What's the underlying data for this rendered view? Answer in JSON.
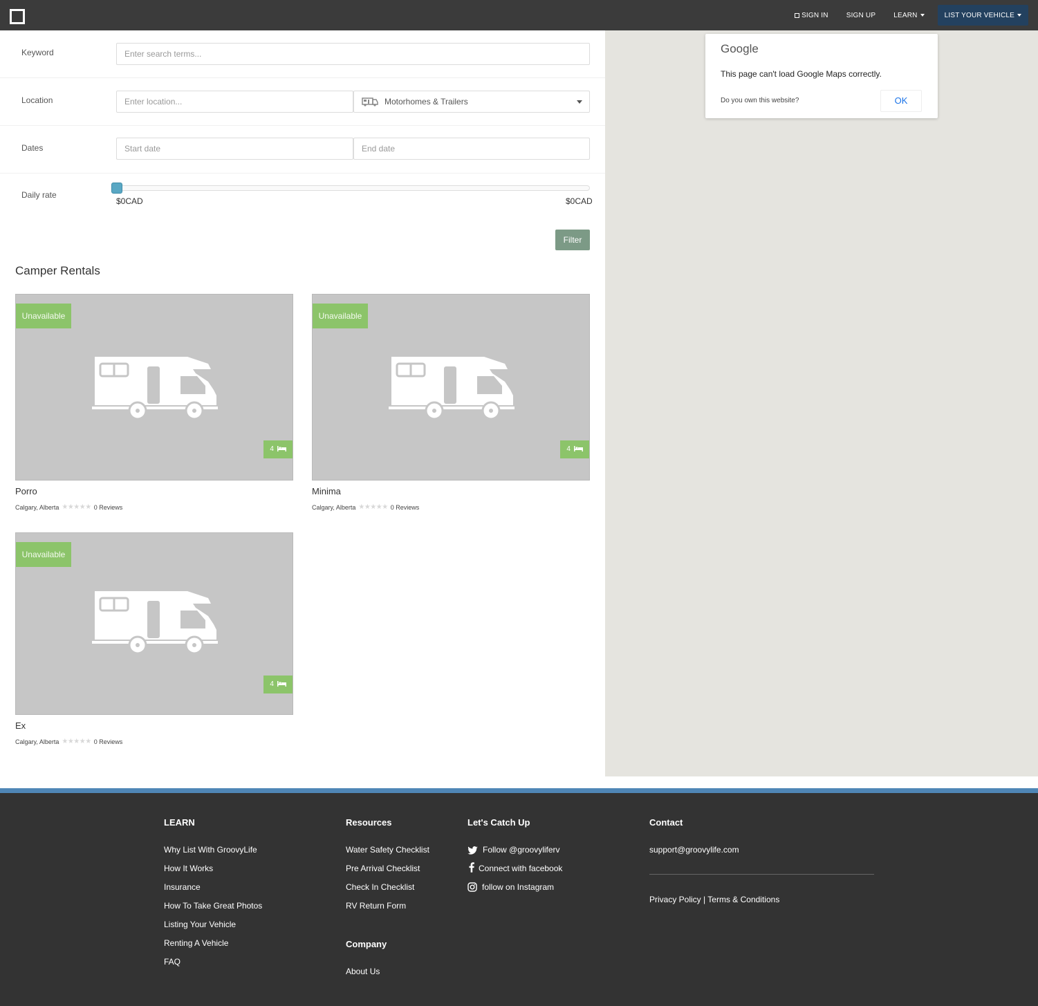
{
  "nav": {
    "sign_in": "SIGN IN",
    "sign_up": "SIGN UP",
    "learn": "LEARN",
    "list_vehicle": "LIST YOUR VEHICLE"
  },
  "search": {
    "keyword_label": "Keyword",
    "keyword_placeholder": "Enter search terms...",
    "location_label": "Location",
    "location_placeholder": "Enter location...",
    "vehicle_type": "Motorhomes & Trailers",
    "dates_label": "Dates",
    "start_placeholder": "Start date",
    "end_placeholder": "End date",
    "rate_label": "Daily rate",
    "rate_min": "$0CAD",
    "rate_max": "$0CAD",
    "filter_button": "Filter"
  },
  "section_title": "Camper Rentals",
  "listings": [
    {
      "status": "Unavailable",
      "beds": "4",
      "name": "Porro",
      "location": "Calgary, Alberta",
      "rating": 0,
      "reviews": "0 Reviews"
    },
    {
      "status": "Unavailable",
      "beds": "4",
      "name": "Minima",
      "location": "Calgary, Alberta",
      "rating": 0,
      "reviews": "0 Reviews"
    },
    {
      "status": "Unavailable",
      "beds": "4",
      "name": "Ex",
      "location": "Calgary, Alberta",
      "rating": 0,
      "reviews": "0 Reviews"
    }
  ],
  "map_error": {
    "brand": "Google",
    "message": "This page can't load Google Maps correctly.",
    "question": "Do you own this website?",
    "ok": "OK"
  },
  "footer": {
    "learn": {
      "heading": "LEARN",
      "links": [
        "Why List With GroovyLife",
        "How It Works",
        "Insurance",
        "How To Take Great Photos",
        "Listing Your Vehicle",
        "Renting A Vehicle",
        "FAQ"
      ]
    },
    "resources": {
      "heading": "Resources",
      "links": [
        "Water Safety Checklist",
        "Pre Arrival Checklist",
        "Check In Checklist",
        "RV Return Form"
      ]
    },
    "company": {
      "heading": "Company",
      "links": [
        "About Us"
      ]
    },
    "social": {
      "heading": "Let's Catch Up",
      "twitter": "Follow @groovyliferv",
      "facebook": "Connect with facebook",
      "instagram": "follow on Instagram"
    },
    "contact": {
      "heading": "Contact",
      "email": "support@groovylife.com",
      "privacy": "Privacy Policy",
      "separator": "|",
      "terms": "Terms & Conditions"
    }
  },
  "colors": {
    "navbar": "#3b3b3b",
    "cta": "#23415f",
    "badge": "#8cc46a",
    "filter": "#7c9a86",
    "footer": "#333333",
    "footer_stripe": "#4f86b6",
    "map": "#e5e4df"
  }
}
